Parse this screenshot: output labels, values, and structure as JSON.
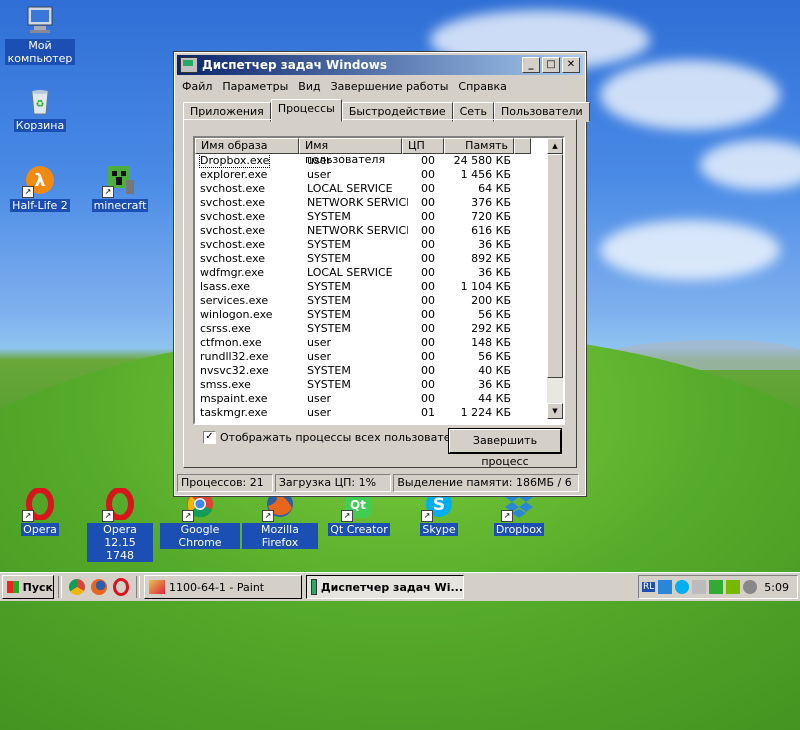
{
  "desktop": {
    "icons": [
      {
        "label": "Мой компьютер",
        "icon": "my-computer-icon"
      },
      {
        "label": "Корзина",
        "icon": "recycle-bin-icon"
      },
      {
        "label": "Half-Life 2",
        "icon": "half-life-icon"
      },
      {
        "label": "minecraft",
        "icon": "minecraft-icon"
      },
      {
        "label": "Opera",
        "icon": "opera-icon"
      },
      {
        "label": "Opera 12.15 1748",
        "icon": "opera-icon"
      },
      {
        "label": "Google Chrome",
        "icon": "chrome-icon"
      },
      {
        "label": "Mozilla Firefox",
        "icon": "firefox-icon"
      },
      {
        "label": "Qt Creator",
        "icon": "qt-creator-icon"
      },
      {
        "label": "Skype",
        "icon": "skype-icon"
      },
      {
        "label": "Dropbox",
        "icon": "dropbox-icon"
      }
    ]
  },
  "window": {
    "title": "Диспетчер задач Windows",
    "menu": [
      "Файл",
      "Параметры",
      "Вид",
      "Завершение работы",
      "Справка"
    ],
    "tabs": [
      "Приложения",
      "Процессы",
      "Быстродействие",
      "Сеть",
      "Пользователи"
    ],
    "active_tab": "Процессы",
    "columns": [
      "Имя образа",
      "Имя пользователя",
      "ЦП",
      "Память"
    ],
    "rows": [
      [
        "Dropbox.exe",
        "user",
        "00",
        "24 580 КБ"
      ],
      [
        "explorer.exe",
        "user",
        "00",
        "1 456 КБ"
      ],
      [
        "svchost.exe",
        "LOCAL SERVICE",
        "00",
        "64 КБ"
      ],
      [
        "svchost.exe",
        "NETWORK SERVICE",
        "00",
        "376 КБ"
      ],
      [
        "svchost.exe",
        "SYSTEM",
        "00",
        "720 КБ"
      ],
      [
        "svchost.exe",
        "NETWORK SERVICE",
        "00",
        "616 КБ"
      ],
      [
        "svchost.exe",
        "SYSTEM",
        "00",
        "36 КБ"
      ],
      [
        "svchost.exe",
        "SYSTEM",
        "00",
        "892 КБ"
      ],
      [
        "wdfmgr.exe",
        "LOCAL SERVICE",
        "00",
        "36 КБ"
      ],
      [
        "lsass.exe",
        "SYSTEM",
        "00",
        "1 104 КБ"
      ],
      [
        "services.exe",
        "SYSTEM",
        "00",
        "200 КБ"
      ],
      [
        "winlogon.exe",
        "SYSTEM",
        "00",
        "56 КБ"
      ],
      [
        "csrss.exe",
        "SYSTEM",
        "00",
        "292 КБ"
      ],
      [
        "ctfmon.exe",
        "user",
        "00",
        "148 КБ"
      ],
      [
        "rundll32.exe",
        "user",
        "00",
        "56 КБ"
      ],
      [
        "nvsvc32.exe",
        "SYSTEM",
        "00",
        "40 КБ"
      ],
      [
        "smss.exe",
        "SYSTEM",
        "00",
        "36 КБ"
      ],
      [
        "mspaint.exe",
        "user",
        "00",
        "44 КБ"
      ],
      [
        "taskmgr.exe",
        "user",
        "01",
        "1 224 КБ"
      ]
    ],
    "show_all_label": "Отображать процессы всех пользователей",
    "show_all_checked": true,
    "end_process_label": "Завершить процесс",
    "status": {
      "processes": "Процессов: 21",
      "cpu": "Загрузка ЦП: 1%",
      "memory": "Выделение памяти: 186МБ / 6"
    }
  },
  "taskbar": {
    "start_label": "Пуск",
    "quicklaunch": [
      "chrome-icon",
      "firefox-icon",
      "recycle-icon"
    ],
    "buttons": [
      {
        "label": "1100-64-1 - Paint",
        "icon": "paint-icon",
        "pressed": false
      },
      {
        "label": "Диспетчер задач Wi...",
        "icon": "taskmgr-icon",
        "pressed": true
      }
    ],
    "tray": {
      "lang": "RL",
      "time": "5:09"
    }
  }
}
